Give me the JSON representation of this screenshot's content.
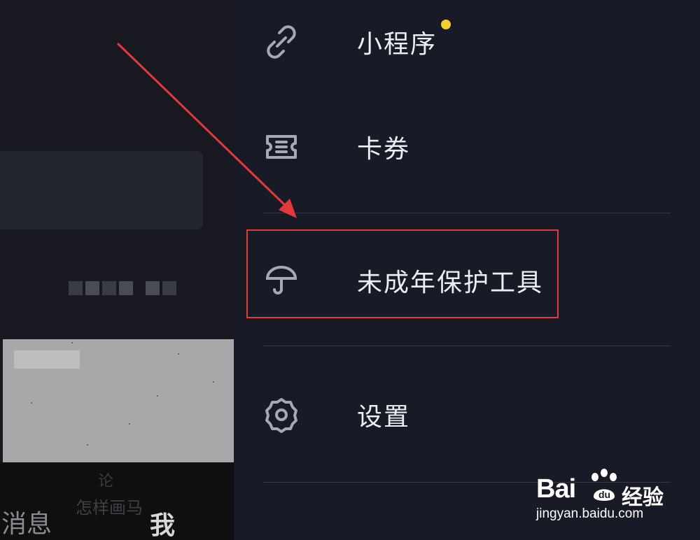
{
  "drawer": {
    "items": [
      {
        "label": "小程序",
        "icon": "link-icon",
        "has_badge": true
      },
      {
        "label": "卡券",
        "icon": "ticket-icon"
      },
      {
        "label": "未成年保护工具",
        "icon": "umbrella-icon"
      },
      {
        "label": "设置",
        "icon": "gear-icon"
      }
    ],
    "badge_color": "#f4d02b"
  },
  "background": {
    "caption_line1": "论",
    "caption_line2": "怎样画马",
    "tabs": [
      "消息",
      "我"
    ]
  },
  "annotation": {
    "highlight_color": "#e23a3a"
  },
  "watermark": {
    "brand": "Bai",
    "brand_tail": "经验",
    "url": "jingyan.baidu.com"
  }
}
